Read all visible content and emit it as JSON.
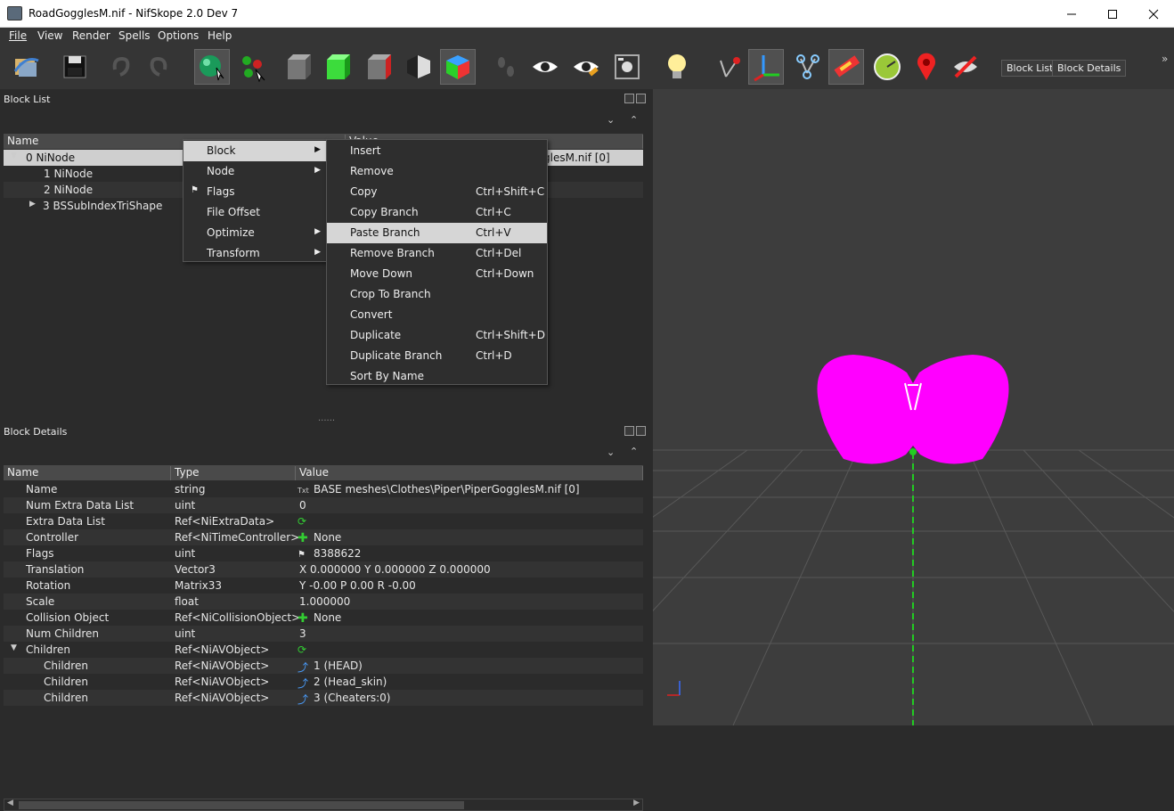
{
  "window": {
    "title": "RoadGogglesM.nif - NifSkope 2.0 Dev 7"
  },
  "menubar": [
    "File",
    "View",
    "Render",
    "Spells",
    "Options",
    "Help"
  ],
  "toolbar": {
    "icons": [
      "load-icon",
      "save-icon",
      "undo-icon",
      "redo-icon",
      "select-object-icon",
      "select-vertex-icon",
      "cube-gray-icon",
      "cube-green-icon",
      "cube-red-icon",
      "cube-flat-icon",
      "cube-color-icon",
      "footprints-icon",
      "eye-icon",
      "eye-edit-icon",
      "snapshot-icon",
      "lightbulb-icon",
      "axes-small-icon",
      "axes-icon",
      "nodes-icon",
      "texture-icon",
      "clock-icon",
      "marker-icon",
      "hide-icon"
    ],
    "block_list_label": "Block List",
    "block_details_label": "Block Details"
  },
  "block_list": {
    "title": "Block List",
    "columns": [
      "Name",
      "Value"
    ],
    "rows": [
      {
        "name": "0 NiNode",
        "value": "glesM.nif [0]",
        "indent": 0,
        "expanded": true
      },
      {
        "name": "1 NiNode",
        "value": "",
        "indent": 1
      },
      {
        "name": "2 NiNode",
        "value": "",
        "indent": 1
      },
      {
        "name": "3 BSSubIndexTriShape",
        "value": "",
        "indent": 1,
        "collapsed": true
      }
    ]
  },
  "context_menu": {
    "items": [
      {
        "label": "Block",
        "submenu": true
      },
      {
        "label": "Node",
        "submenu": true
      },
      {
        "label": "Flags",
        "icon": "flag-icon"
      },
      {
        "label": "File Offset"
      },
      {
        "label": "Optimize",
        "submenu": true
      },
      {
        "label": "Transform",
        "submenu": true
      }
    ],
    "submenu": [
      {
        "label": "Insert",
        "shortcut": ""
      },
      {
        "label": "Remove",
        "shortcut": ""
      },
      {
        "label": "Copy",
        "shortcut": "Ctrl+Shift+C"
      },
      {
        "label": "Copy Branch",
        "shortcut": "Ctrl+C"
      },
      {
        "label": "Paste Branch",
        "shortcut": "Ctrl+V"
      },
      {
        "label": "Remove Branch",
        "shortcut": "Ctrl+Del"
      },
      {
        "label": "Move Down",
        "shortcut": "Ctrl+Down"
      },
      {
        "label": "Crop To Branch",
        "shortcut": ""
      },
      {
        "label": "Convert",
        "shortcut": ""
      },
      {
        "label": "Duplicate",
        "shortcut": "Ctrl+Shift+D"
      },
      {
        "label": "Duplicate Branch",
        "shortcut": "Ctrl+D"
      },
      {
        "label": "Sort By Name",
        "shortcut": ""
      }
    ]
  },
  "block_details": {
    "title": "Block Details",
    "columns": [
      "Name",
      "Type",
      "Value"
    ],
    "rows": [
      {
        "name": "Name",
        "type": "string",
        "value": "BASE meshes\\Clothes\\Piper\\PiperGogglesM.nif [0]",
        "icon": "txt"
      },
      {
        "name": "Num Extra Data List",
        "type": "uint",
        "value": "0"
      },
      {
        "name": "Extra Data List",
        "type": "Ref<NiExtraData>",
        "value": "",
        "icon": "link"
      },
      {
        "name": "Controller",
        "type": "Ref<NiTimeController>",
        "value": "None",
        "icon": "plus"
      },
      {
        "name": "Flags",
        "type": "uint",
        "value": "8388622",
        "icon": "flag"
      },
      {
        "name": "Translation",
        "type": "Vector3",
        "value": "X 0.000000 Y 0.000000 Z 0.000000"
      },
      {
        "name": "Rotation",
        "type": "Matrix33",
        "value": "Y -0.00 P 0.00 R -0.00"
      },
      {
        "name": "Scale",
        "type": "float",
        "value": "1.000000"
      },
      {
        "name": "Collision Object",
        "type": "Ref<NiCollisionObject>",
        "value": "None",
        "icon": "plus"
      },
      {
        "name": "Num Children",
        "type": "uint",
        "value": "3"
      },
      {
        "name": "Children",
        "type": "Ref<NiAVObject>",
        "value": "",
        "icon": "link",
        "expanded": true
      },
      {
        "name": "Children",
        "type": "Ref<NiAVObject>",
        "value": "1 (HEAD)",
        "icon": "ref",
        "child": true
      },
      {
        "name": "Children",
        "type": "Ref<NiAVObject>",
        "value": "2 (Head_skin)",
        "icon": "ref",
        "child": true
      },
      {
        "name": "Children",
        "type": "Ref<NiAVObject>",
        "value": "3 (Cheaters:0)",
        "icon": "ref",
        "child": true
      }
    ]
  },
  "colors": {
    "accent_magenta": "#ff00ff",
    "axis_green": "#22cc22",
    "selection": "#cfcfcf"
  }
}
